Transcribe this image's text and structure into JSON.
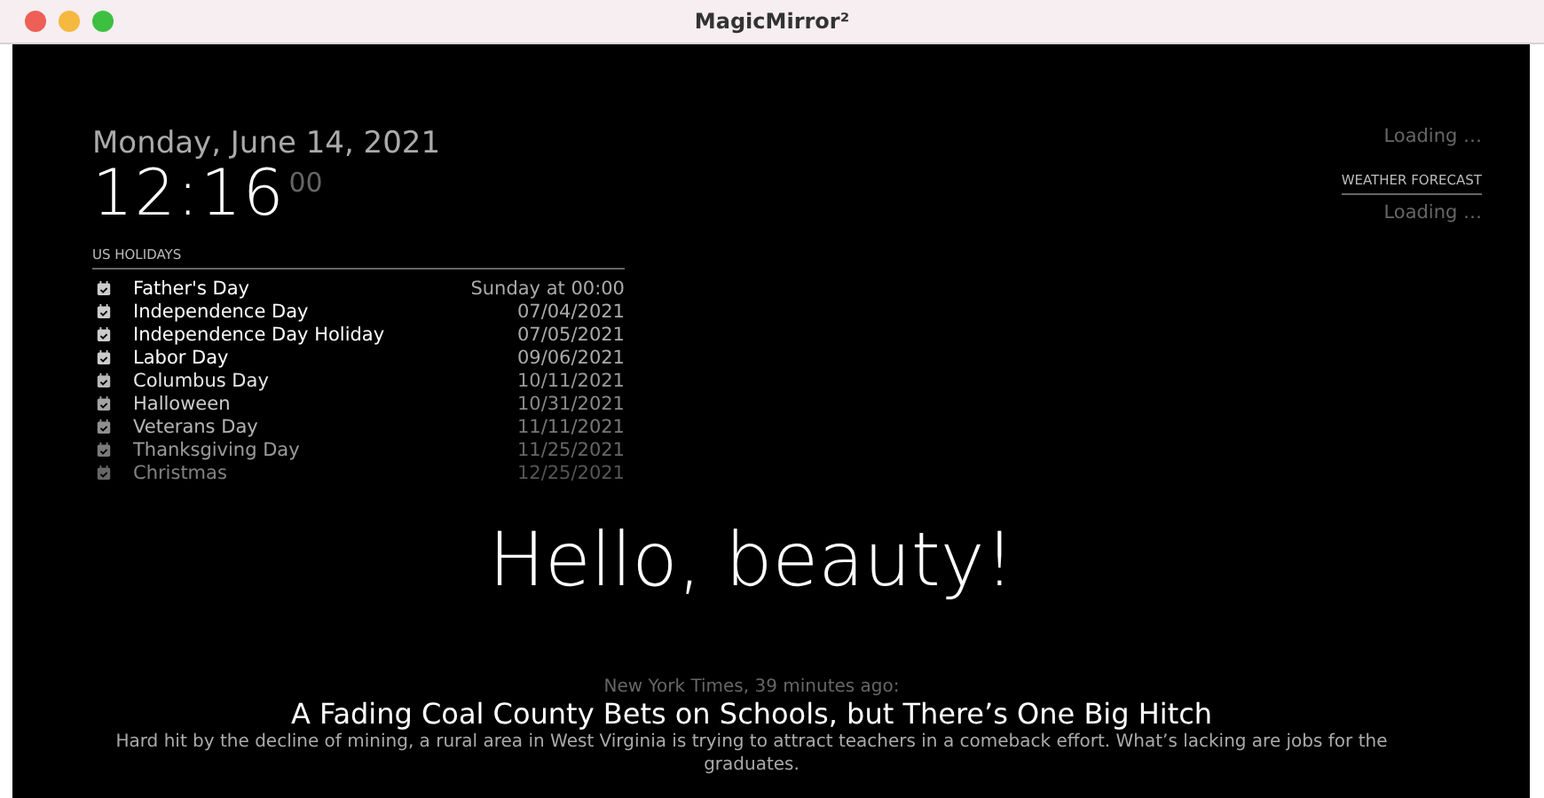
{
  "window": {
    "title": "MagicMirror²"
  },
  "clock": {
    "date": "Monday, June 14, 2021",
    "time": "12:16",
    "seconds": "00"
  },
  "calendar": {
    "header": "US HOLIDAYS",
    "events": [
      {
        "title": "Father's Day",
        "when": "Sunday at 00:00"
      },
      {
        "title": "Independence Day",
        "when": "07/04/2021"
      },
      {
        "title": "Independence Day Holiday",
        "when": "07/05/2021"
      },
      {
        "title": "Labor Day",
        "when": "09/06/2021"
      },
      {
        "title": "Columbus Day",
        "when": "10/11/2021"
      },
      {
        "title": "Halloween",
        "when": "10/31/2021"
      },
      {
        "title": "Veterans Day",
        "when": "11/11/2021"
      },
      {
        "title": "Thanksgiving Day",
        "when": "11/25/2021"
      },
      {
        "title": "Christmas",
        "when": "12/25/2021"
      }
    ]
  },
  "weather": {
    "current": "Loading …",
    "forecast_header": "WEATHER FORECAST",
    "forecast": "Loading …"
  },
  "compliment": "Hello, beauty!",
  "news": {
    "source": "New York Times, 39 minutes ago:",
    "headline": "A Fading Coal County Bets on Schools, but There’s One Big Hitch",
    "description": "Hard hit by the decline of mining, a rural area in West Virginia is trying to attract teachers in a comeback effort. What’s lacking are jobs for the graduates."
  }
}
